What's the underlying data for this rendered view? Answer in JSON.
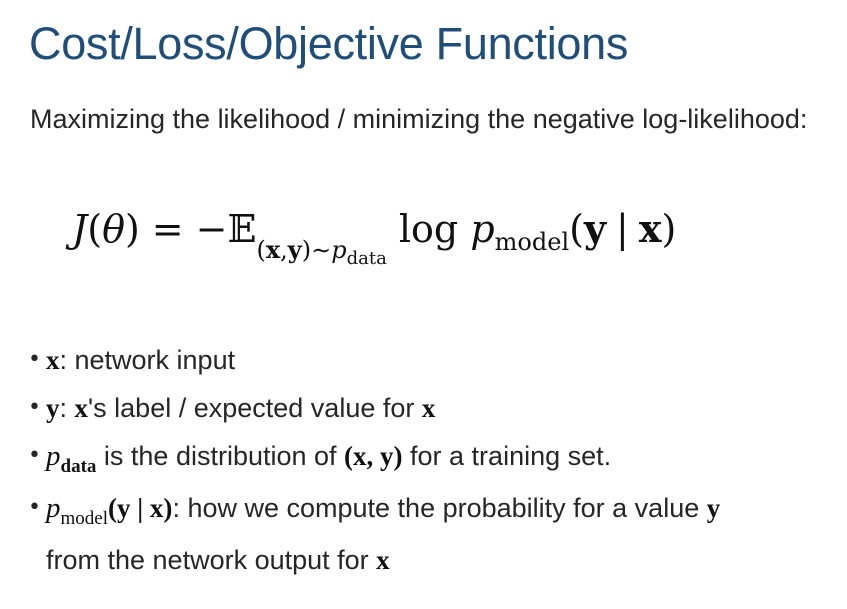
{
  "slide": {
    "title": "Cost/Loss/Objective Functions",
    "intro": "Maximizing the likelihood / minimizing the negative log-likelihood:"
  },
  "equation": {
    "lhs_func": "J",
    "lhs_open": "(",
    "lhs_var": "θ",
    "lhs_close": ")",
    "equals": "=",
    "minus_E": "−𝔼",
    "sub_open": "(",
    "sub_x": "x",
    "sub_comma": ",",
    "sub_y": "y",
    "sub_close": ")",
    "sub_tilde": "∼",
    "sub_p": "p",
    "sub_data": "data",
    "log": "log",
    "p": "p",
    "model": "model",
    "arg_open": "(",
    "arg_y": "y",
    "arg_bar": "|",
    "arg_x": "x",
    "arg_close": ")"
  },
  "bullets": {
    "b1": {
      "sym": "x",
      "text": ": network input"
    },
    "b2": {
      "sym": "y",
      "text1": ": ",
      "sym2": "x",
      "text2": "'s label / expected value for ",
      "sym3": "x"
    },
    "b3": {
      "sym": "p",
      "sub": "data",
      "text1": " is the distribution of ",
      "math": "(x, y)",
      "text2": " for a training set."
    },
    "b4": {
      "sym": "p",
      "sub": "model",
      "math": "(y | x)",
      "text1": ": how we compute the probability for a value ",
      "sym2": "y",
      "line2": "from the network output for ",
      "sym3": "x"
    },
    "bullet_char": "•"
  }
}
